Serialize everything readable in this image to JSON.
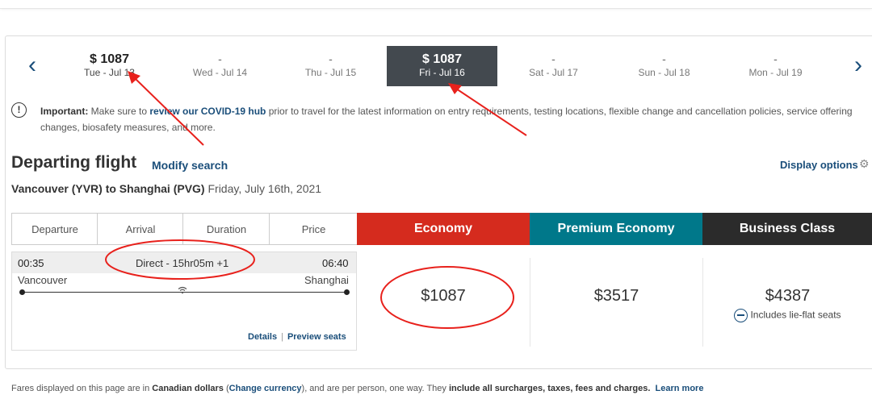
{
  "dates": [
    {
      "price": "$ 1087",
      "date": "Tue - Jul 13"
    },
    {
      "price": "-",
      "date": "Wed - Jul 14"
    },
    {
      "price": "-",
      "date": "Thu - Jul 15"
    },
    {
      "price": "$ 1087",
      "date": "Fri - Jul 16"
    },
    {
      "price": "-",
      "date": "Sat - Jul 17"
    },
    {
      "price": "-",
      "date": "Sun - Jul 18"
    },
    {
      "price": "-",
      "date": "Mon - Jul 19"
    }
  ],
  "nav": {
    "prev": "‹",
    "next": "›"
  },
  "notice": {
    "icon": "!",
    "important": "Important:",
    "text1": " Make sure to ",
    "link": "review our COVID-19 hub",
    "text2": " prior to travel for the latest information on entry requirements, testing locations, flexible change and cancellation policies, service offering changes, biosafety measures, and more."
  },
  "heading": {
    "title": "Departing flight",
    "modify": "Modify search",
    "display_options": "Display options",
    "route_bold": "Vancouver (YVR) to Shanghai (PVG)",
    "route_date": " Friday, July 16th, 2021"
  },
  "columns": [
    "Departure",
    "Arrival",
    "Duration",
    "Price"
  ],
  "cabins": [
    {
      "label": "Economy",
      "color": "#d52b1e"
    },
    {
      "label": "Premium Economy",
      "color": "#00788a"
    },
    {
      "label": "Business Class",
      "color": "#2b2b2b"
    }
  ],
  "flight": {
    "dep_time": "00:35",
    "summary": "Direct - 15hr05m +1",
    "arr_time": "06:40",
    "dep_city": "Vancouver",
    "arr_city": "Shanghai",
    "details": "Details",
    "separator": "|",
    "preview": "Preview seats",
    "wifi_icon": "wifi-icon"
  },
  "fares": {
    "economy": "$1087",
    "premium": "$3517",
    "business": "$4387",
    "business_perk": "Includes lie-flat seats"
  },
  "footer": {
    "t1": "Fares displayed on this page are in ",
    "b1": "Canadian dollars",
    "t2": " (",
    "link1": "Change currency",
    "t3": "), and are per person, one way. They ",
    "b2": "include all surcharges, taxes, fees and charges.",
    "link2": "Learn more"
  },
  "annotation_color": "#e8211c"
}
